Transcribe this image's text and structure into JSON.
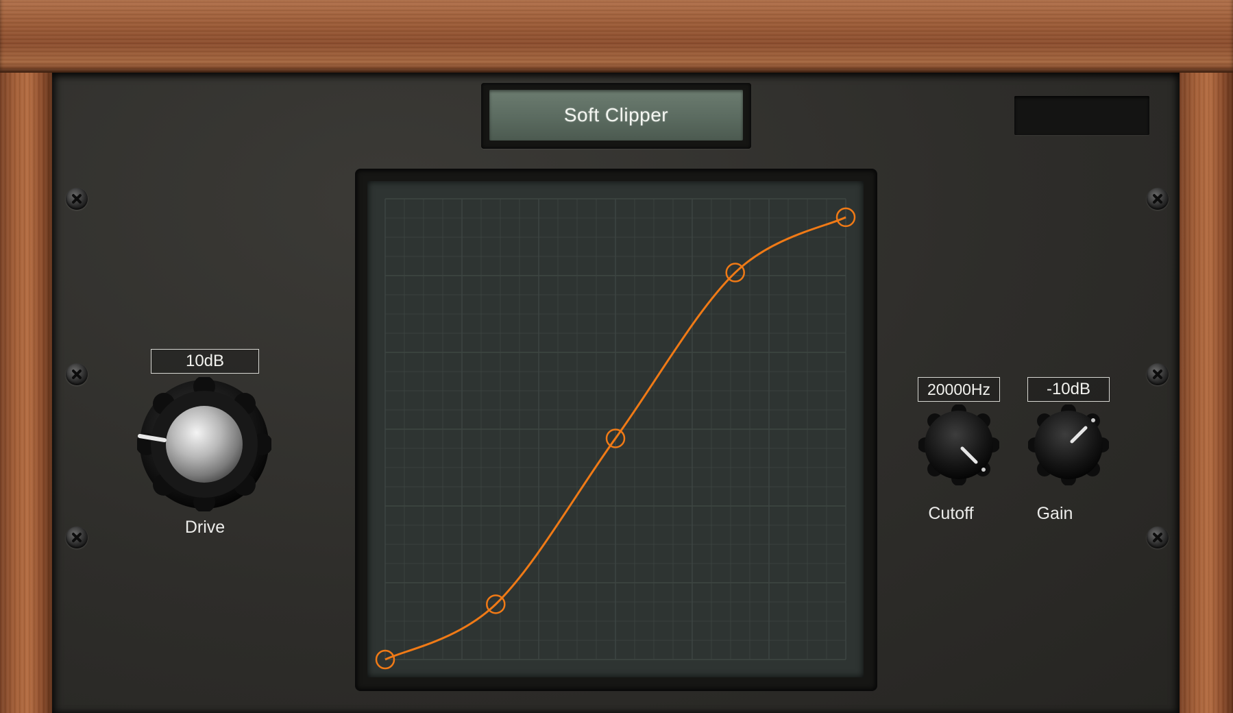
{
  "plugin": {
    "title": "Soft Clipper"
  },
  "drive": {
    "value": "10dB",
    "label": "Drive"
  },
  "cutoff": {
    "value": "20000Hz",
    "label": "Cutoff"
  },
  "gain": {
    "value": "-10dB",
    "label": "Gain"
  },
  "curve": {
    "color": "#f07a16",
    "grid_color": "#3e4643",
    "points": [
      {
        "x": 0.0,
        "y": 0.0
      },
      {
        "x": 0.24,
        "y": 0.12
      },
      {
        "x": 0.5,
        "y": 0.48
      },
      {
        "x": 0.76,
        "y": 0.84
      },
      {
        "x": 1.0,
        "y": 0.96
      }
    ]
  },
  "colors": {
    "panel": "#2e2d2a",
    "wood": "#9a5a36",
    "lcd": "#5b6b60"
  }
}
